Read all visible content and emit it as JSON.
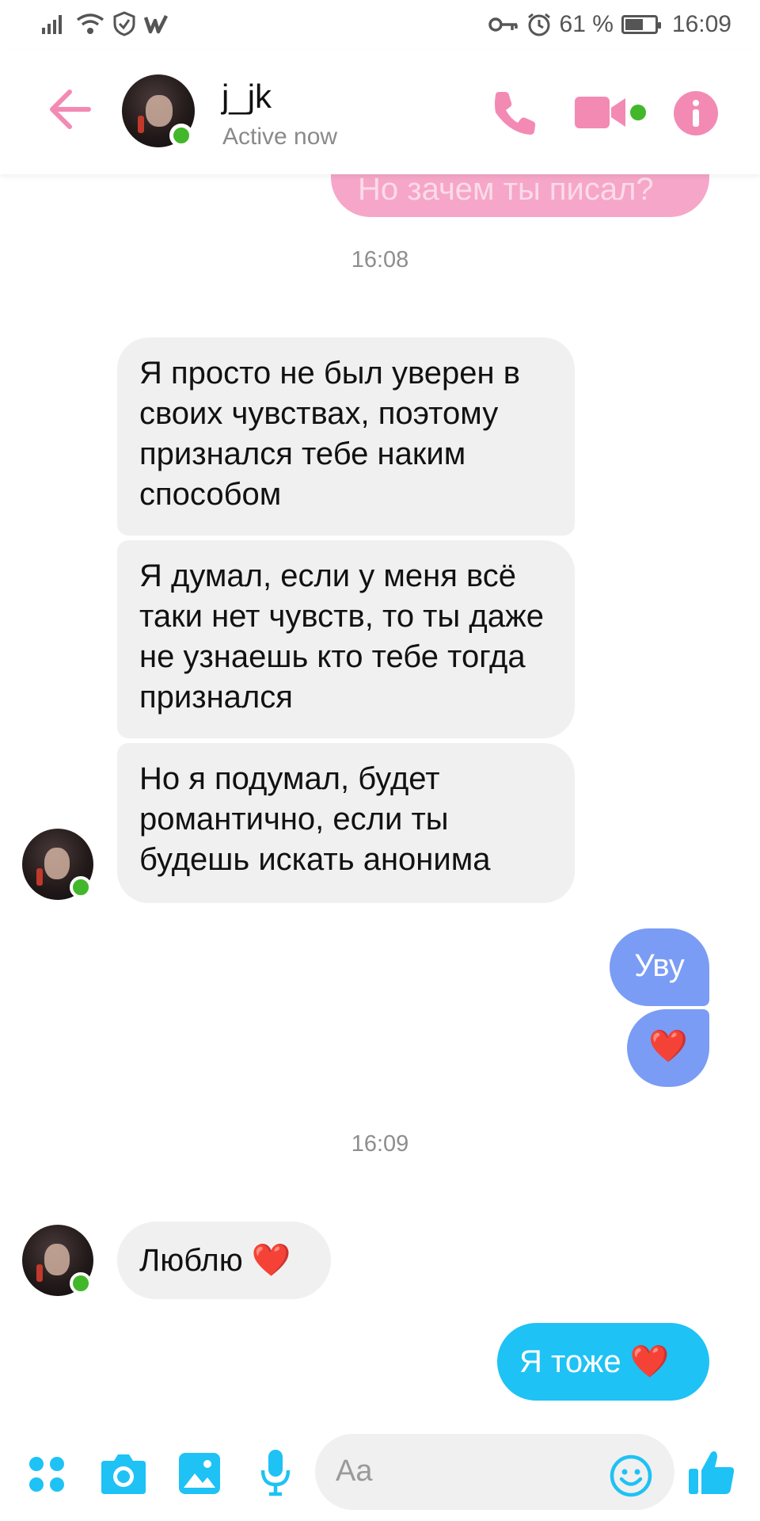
{
  "status_bar": {
    "battery": "61 %",
    "battery_level": 0.61,
    "time": "16:09"
  },
  "header": {
    "contact_name": "j_jk",
    "status": "Active now"
  },
  "conversation": {
    "partial_outgoing": "Но зачем ты писал?",
    "timestamps": [
      "16:08",
      "16:09"
    ],
    "incoming_group": [
      "Я просто не был уверен в своих чувствах, поэтому признался тебе наким способом",
      "Я думал, если у меня всё таки нет чувств, то ты даже не узнаешь кто тебе тогда признался",
      "Но я подумал, будет романтично, если ты будешь искать анонима"
    ],
    "outgoing_1": "Уву",
    "outgoing_heart": "❤️",
    "incoming_love": "Люблю ❤️",
    "outgoing_2": "Я тоже ❤️"
  },
  "composer": {
    "placeholder": "Aa"
  },
  "colors": {
    "accent_pink": "#f6a6c8",
    "bubble_blue": "#7a9cf5",
    "bubble_cyan": "#1ec2f5",
    "online_green": "#42b72a",
    "composer_icon": "#1ec2f5"
  }
}
